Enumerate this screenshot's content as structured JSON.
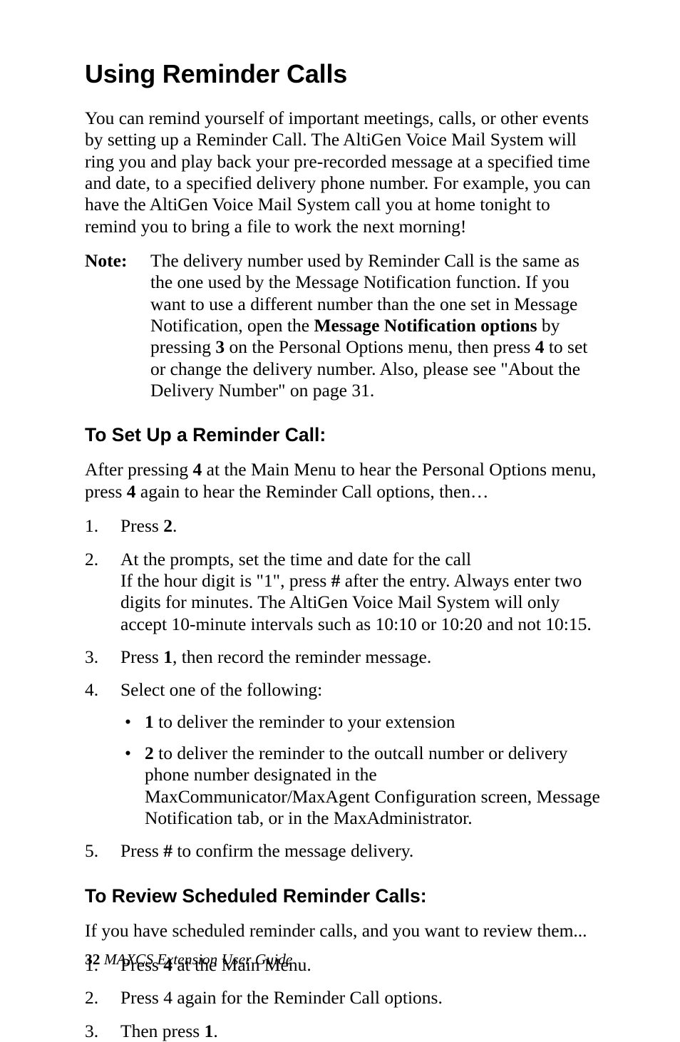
{
  "heading": "Using Reminder Calls",
  "intro": "You can remind yourself of important meetings, calls, or other events by setting up a Reminder Call. The AltiGen Voice Mail System will ring you and play back your pre-recorded message at a specified time and date, to a specified delivery phone number. For example, you can have the AltiGen Voice Mail System call you at home tonight to remind you to bring a file to work the next morning!",
  "note": {
    "label": "Note:",
    "seg1": "The delivery number used by Reminder Call is the same as the one used by the Message Notification function. If you want to use a different number than the one set in Message Notification, open the ",
    "bold1": "Message Notification options",
    "seg2": " by pressing ",
    "bold2": "3",
    "seg3": " on the Personal Options menu, then press ",
    "bold3": "4",
    "seg4": " to set or change the delivery number. Also, please see \"About the Delivery Number\" on page 31."
  },
  "section1": {
    "title": "To Set Up a Reminder Call:",
    "lead_seg1": "After pressing ",
    "lead_b1": "4",
    "lead_seg2": " at the Main Menu to hear the Personal Options menu, press ",
    "lead_b2": "4",
    "lead_seg3": " again to hear the Reminder Call options, then…",
    "items": {
      "i1_seg1": "Press ",
      "i1_b": "2",
      "i1_seg2": ".",
      "i2_seg1": "At the prompts, set the time and date for the call",
      "i2_seg2": "If the hour digit is \"1\", press ",
      "i2_b1": "#",
      "i2_seg3": " after the entry. Always enter two digits for minutes. The AltiGen Voice Mail System will only accept 10-minute intervals such as 10:10 or 10:20 and not 10:15.",
      "i3_seg1": "Press ",
      "i3_b": "1",
      "i3_seg2": ", then record the reminder message.",
      "i4_seg1": "Select one of the following:",
      "i4_bul1_b": "1",
      "i4_bul1_seg": " to deliver the reminder to your extension",
      "i4_bul2_b": "2",
      "i4_bul2_seg": " to deliver the reminder to the outcall number or delivery phone number designated in the MaxCommunicator/MaxAgent Configuration screen, Message Notification tab, or in the MaxAdministrator.",
      "i5_seg1": "Press ",
      "i5_b": "#",
      "i5_seg2": " to confirm the message delivery."
    }
  },
  "section2": {
    "title": "To Review Scheduled Reminder Calls:",
    "lead": "If you have scheduled reminder calls, and you want to review them...",
    "items": {
      "i1_seg1": "Press ",
      "i1_b": "4",
      "i1_seg2": " at the Main Menu.",
      "i2": "Press 4 again for the Reminder Call options.",
      "i3_seg1": "Then press ",
      "i3_b": "1",
      "i3_seg2": "."
    }
  },
  "footer": {
    "page": "32",
    "sep": "   ",
    "book": "MAXCS Extension User Guide"
  }
}
